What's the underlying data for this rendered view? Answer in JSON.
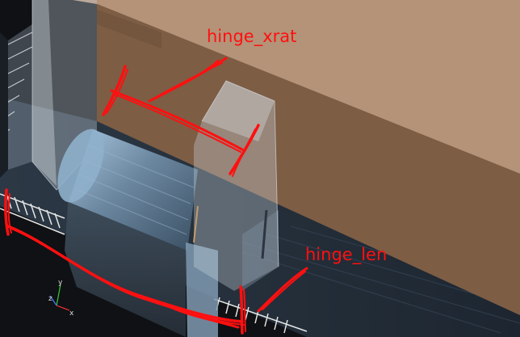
{
  "annotations": {
    "hinge_xrat": "hinge_xrat",
    "hinge_len": "hinge_len"
  },
  "axes_indicator": {
    "y": "y",
    "z": "z",
    "x": "x"
  },
  "colors": {
    "background": "#0f1114",
    "lid_top": "#b49378",
    "lid_side": "#7d5d44",
    "annotation": "#ff1010",
    "barrel": "#6e8aa4"
  }
}
